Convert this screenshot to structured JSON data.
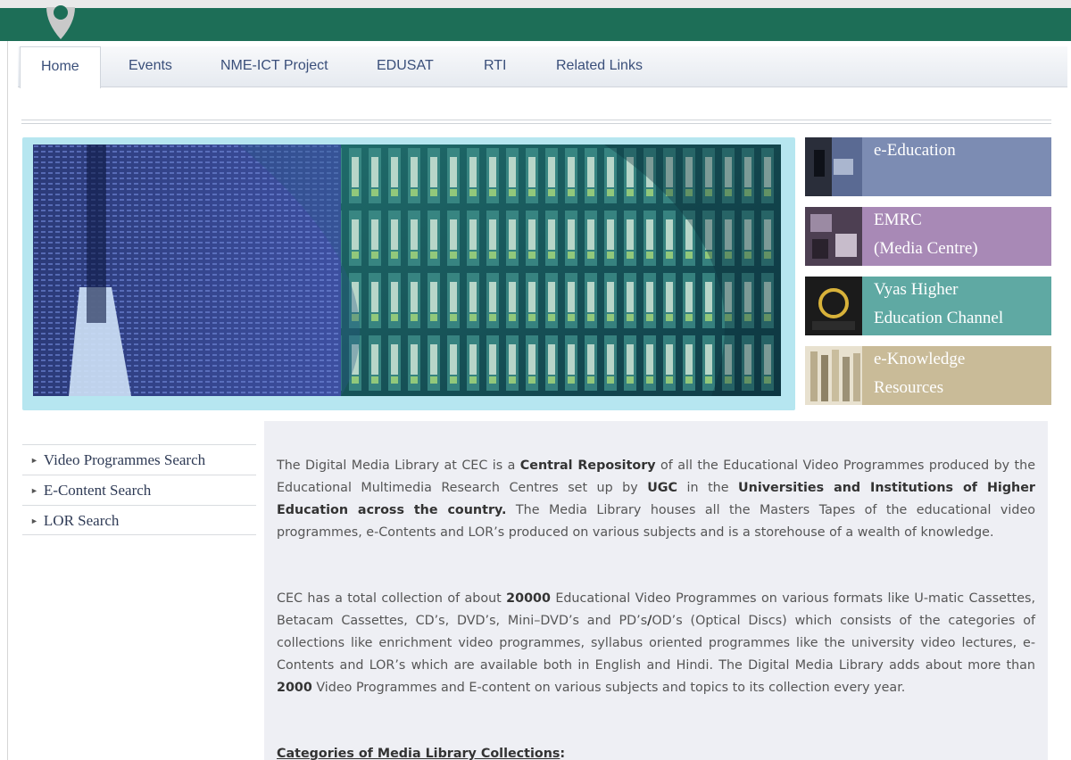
{
  "nav": {
    "tabs": [
      {
        "label": "Home"
      },
      {
        "label": "Events"
      },
      {
        "label": "NME-ICT Project"
      },
      {
        "label": "EDUSAT"
      },
      {
        "label": "RTI"
      },
      {
        "label": "Related Links"
      }
    ],
    "active_tab": "Home"
  },
  "colors": {
    "header_green": "#1d6e57",
    "tile_eeducation": "#7c8cb3",
    "tile_emrc": "#a889b6",
    "tile_vyas": "#5fa9a3",
    "tile_eknowledge": "#c9bb98",
    "banner_border": "#b6e6f0"
  },
  "tiles": [
    {
      "line1": "e-Education",
      "line2": "",
      "icon": "computer-user-icon"
    },
    {
      "line1": "EMRC",
      "line2": "(Media Centre)",
      "icon": "media-centre-icon"
    },
    {
      "line1": "Vyas Higher",
      "line2": "Education Channel",
      "icon": "ugc-cec-logo-icon"
    },
    {
      "line1": "e-Knowledge",
      "line2": "Resources",
      "icon": "bookshelf-icon"
    }
  ],
  "sidebar": {
    "items": [
      {
        "label": "Video Programmes Search"
      },
      {
        "label": "E-Content Search"
      },
      {
        "label": "LOR Search"
      }
    ]
  },
  "content": {
    "p1": {
      "t1": "The Digital Media Library at CEC is a ",
      "b1": "Central Repository",
      "t2": " of all the Educational Video Programmes produced by the  Educational Multimedia Research Centres set up by ",
      "b2": "UGC",
      "t3": " in the ",
      "b3": "Universities and Institutions of Higher Education across the country.",
      "t4": " The Media Library houses all the Masters Tapes of the educational video programmes, e-Contents and LOR’s produced on various subjects and is a storehouse of a wealth of knowledge."
    },
    "p2": {
      "t1": "CEC has a total collection of about ",
      "b1": "20000",
      "t2": " Educational Video Programmes on various formats like U-matic Cassettes, Betacam Cassettes, CD’s, DVD’s, Mini–DVD’s and PD’s",
      "b2": "/",
      "t3": "OD’s (Optical Discs) which consists of the categories of collections like enrichment video programmes, syllabus oriented programmes like the university video lectures, e-Contents and LOR’s which are available both  in English and Hindi.  The Digital Media Library adds about more than ",
      "b3": "2000",
      "t4": "  Video   Programmes and  E-content on various subjects and topics to its collection every year."
    },
    "heading": "Categories of Media Library Collections",
    "heading_suffix": ":"
  }
}
